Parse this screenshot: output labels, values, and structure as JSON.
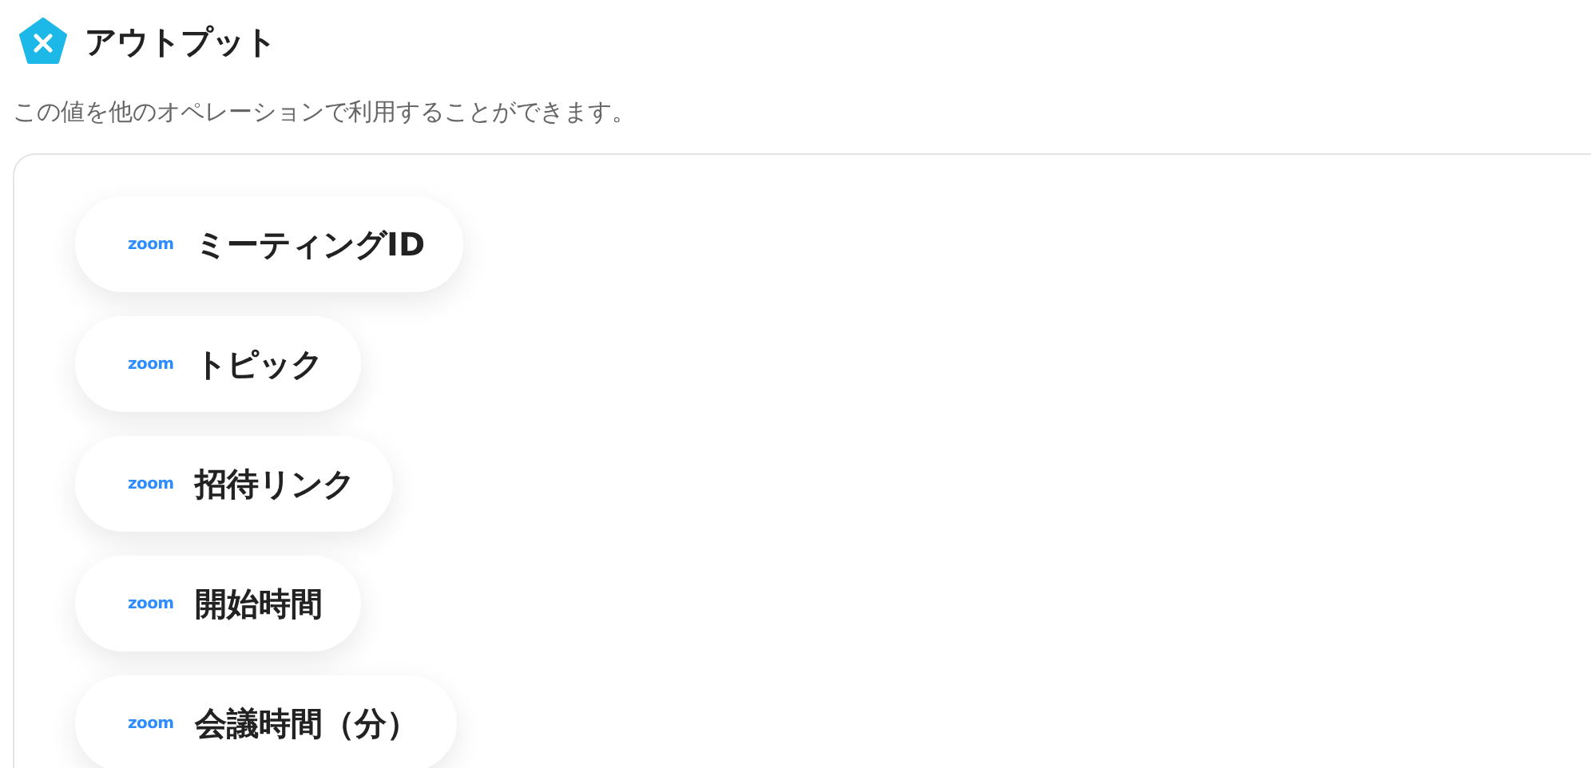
{
  "header": {
    "title": "アウトプット",
    "description": "この値を他のオペレーションで利用することができます。"
  },
  "outputs": [
    {
      "logo": "zoom",
      "label": "ミーティングID"
    },
    {
      "logo": "zoom",
      "label": "トピック"
    },
    {
      "logo": "zoom",
      "label": "招待リンク"
    },
    {
      "logo": "zoom",
      "label": "開始時間"
    },
    {
      "logo": "zoom",
      "label": "会議時間（分）"
    }
  ]
}
